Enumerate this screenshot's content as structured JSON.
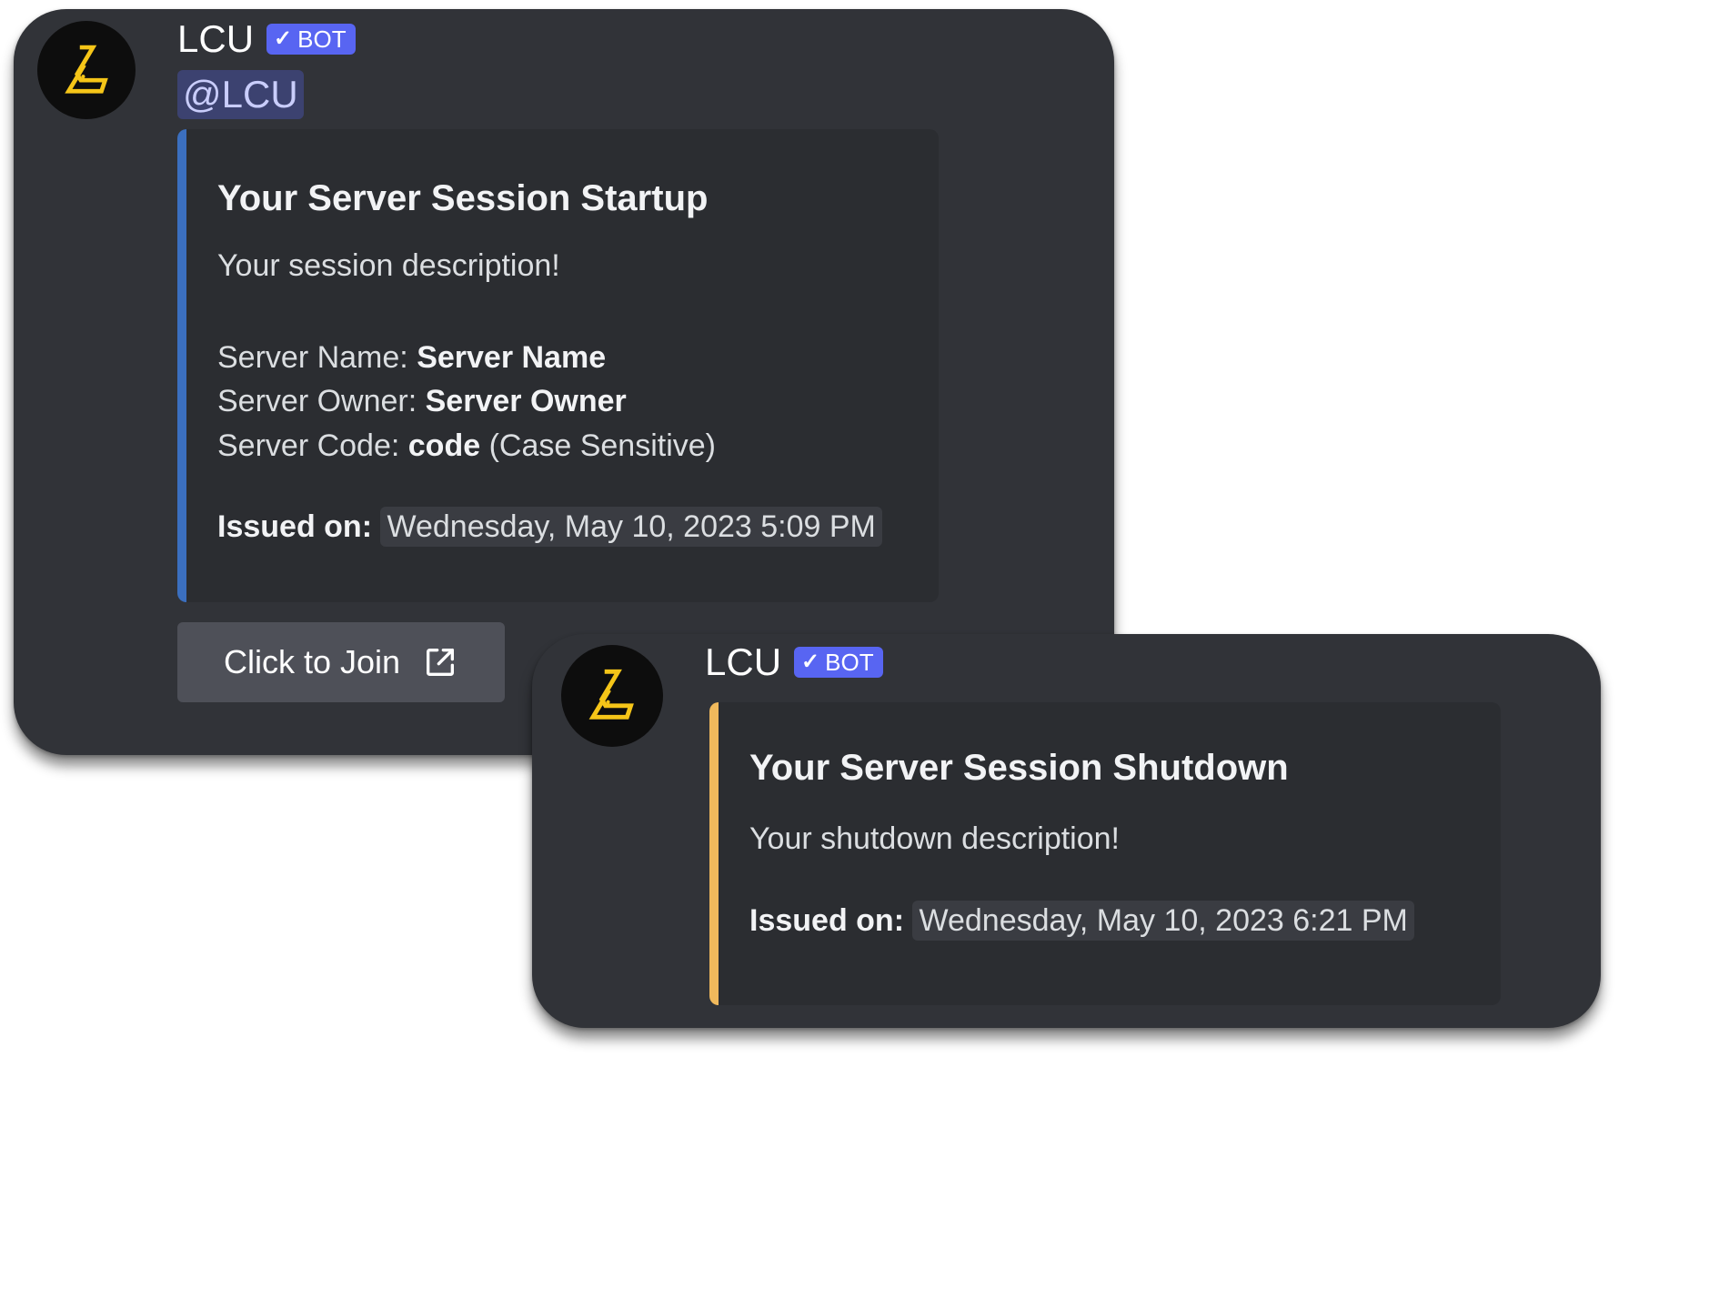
{
  "colors": {
    "card_bg": "#313338",
    "embed_bg": "#2b2d31",
    "bot_badge": "#5865f2",
    "startup_accent": "#3b6fbf",
    "shutdown_accent": "#f0b95c",
    "logo_yellow": "#f5c518",
    "button_bg": "#4e5058"
  },
  "startup": {
    "username": "LCU",
    "badge": "BOT",
    "badge_icon": "check-icon",
    "mention": "@LCU",
    "embed": {
      "title": "Your Server Session Startup",
      "description": "Your session description!",
      "fields": [
        {
          "label": "Server Name: ",
          "value": "Server Name",
          "suffix": ""
        },
        {
          "label": "Server Owner: ",
          "value": "Server Owner",
          "suffix": ""
        },
        {
          "label": "Server Code: ",
          "value": "code",
          "suffix": " (Case Sensitive)"
        }
      ],
      "issued_label": "Issued on:",
      "issued_value": "Wednesday, May 10, 2023 5:09 PM"
    },
    "button": {
      "label": "Click to Join",
      "icon": "external-link-icon"
    }
  },
  "shutdown": {
    "username": "LCU",
    "badge": "BOT",
    "badge_icon": "check-icon",
    "embed": {
      "title": "Your Server Session Shutdown",
      "description": "Your shutdown description!",
      "issued_label": "Issued on:",
      "issued_value": "Wednesday, May 10, 2023 6:21 PM"
    }
  }
}
